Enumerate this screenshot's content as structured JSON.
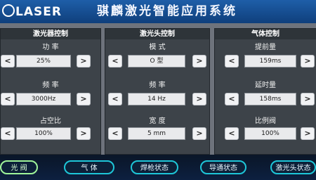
{
  "header": {
    "logo_text": "LASER",
    "title": "骐麟激光智能应用系统"
  },
  "panels": [
    {
      "title": "激光器控制",
      "fields": [
        {
          "label": "功 率",
          "value": "25%"
        },
        {
          "label": "频 率",
          "value": "3000Hz"
        },
        {
          "label": "占空比",
          "value": "100%"
        }
      ]
    },
    {
      "title": "激光头控制",
      "fields": [
        {
          "label": "模 式",
          "value": "O 型"
        },
        {
          "label": "频 率",
          "value": "14 Hz"
        },
        {
          "label": "宽 度",
          "value": "5 mm"
        }
      ]
    },
    {
      "title": "气体控制",
      "fields": [
        {
          "label": "提前量",
          "value": "159ms"
        },
        {
          "label": "延时量",
          "value": "158ms"
        },
        {
          "label": "比例阀",
          "value": "100%"
        }
      ]
    }
  ],
  "arrows": {
    "left": "<",
    "right": ">"
  },
  "footer": {
    "buttons": [
      "光 阀",
      "气 体",
      "焊枪状态",
      "导通状态",
      "激光头状态"
    ]
  },
  "colors": {
    "accent": "#1ec6d8",
    "active": "#9ff59a",
    "header": "#1e5ea8"
  }
}
